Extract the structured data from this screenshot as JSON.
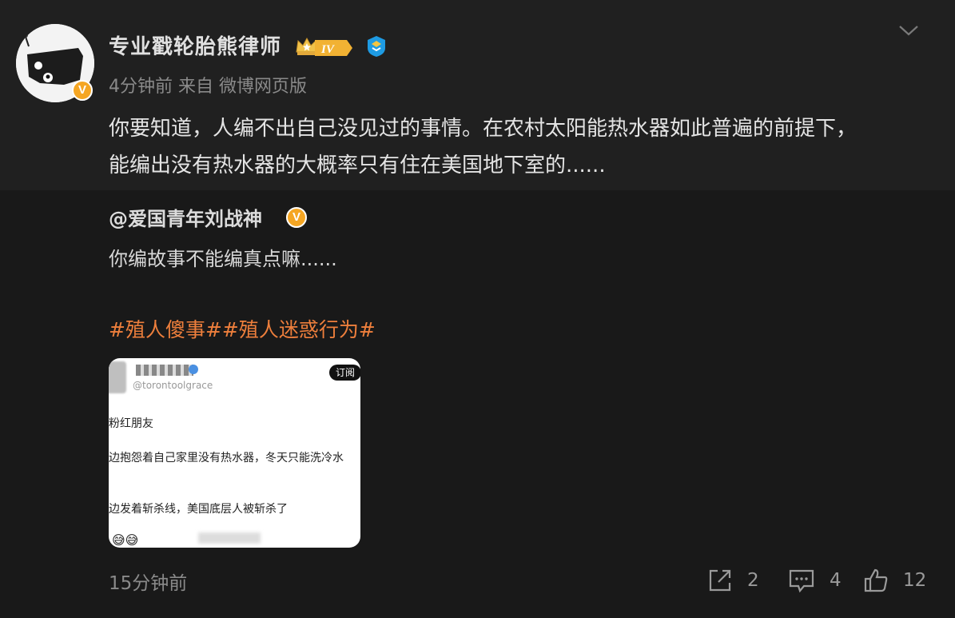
{
  "post": {
    "author": "专业戳轮胎熊律师",
    "level": "IV",
    "meta": "4分钟前 来自 微博网页版",
    "text_line1": "你要知道，人编不出自己没见过的事情。在农村太阳能热水器如此普遍的前提下，",
    "text_line2": "能编出没有热水器的大概率只有住在美国地下室的......"
  },
  "repost": {
    "author": "@爱国青年刘战神",
    "text": "你编故事不能编真点嘛......",
    "hashtags": [
      "#殖人傻事#",
      "#殖人迷惑行为#"
    ],
    "image": {
      "handle": "@torontoolgrace",
      "subscribe": "订阅",
      "line1": "粉红朋友",
      "line2": "边抱怨着自己家里没有热水器，冬天只能洗冷水",
      "line3": "边发着斩杀线，美国底层人被斩杀了",
      "emoji": "😅😅"
    },
    "timestamp": "15分钟前",
    "share_count": "2",
    "comment_count": "4",
    "like_count": "12"
  },
  "colors": {
    "background": "#1b1b1b",
    "hashtag": "#ee7f3c",
    "badge": "#f5a623",
    "verified": "#1e9be3"
  },
  "icons": [
    "chevron-down-icon",
    "crown-icon",
    "verified-icon",
    "share-icon",
    "comment-icon",
    "like-icon"
  ]
}
